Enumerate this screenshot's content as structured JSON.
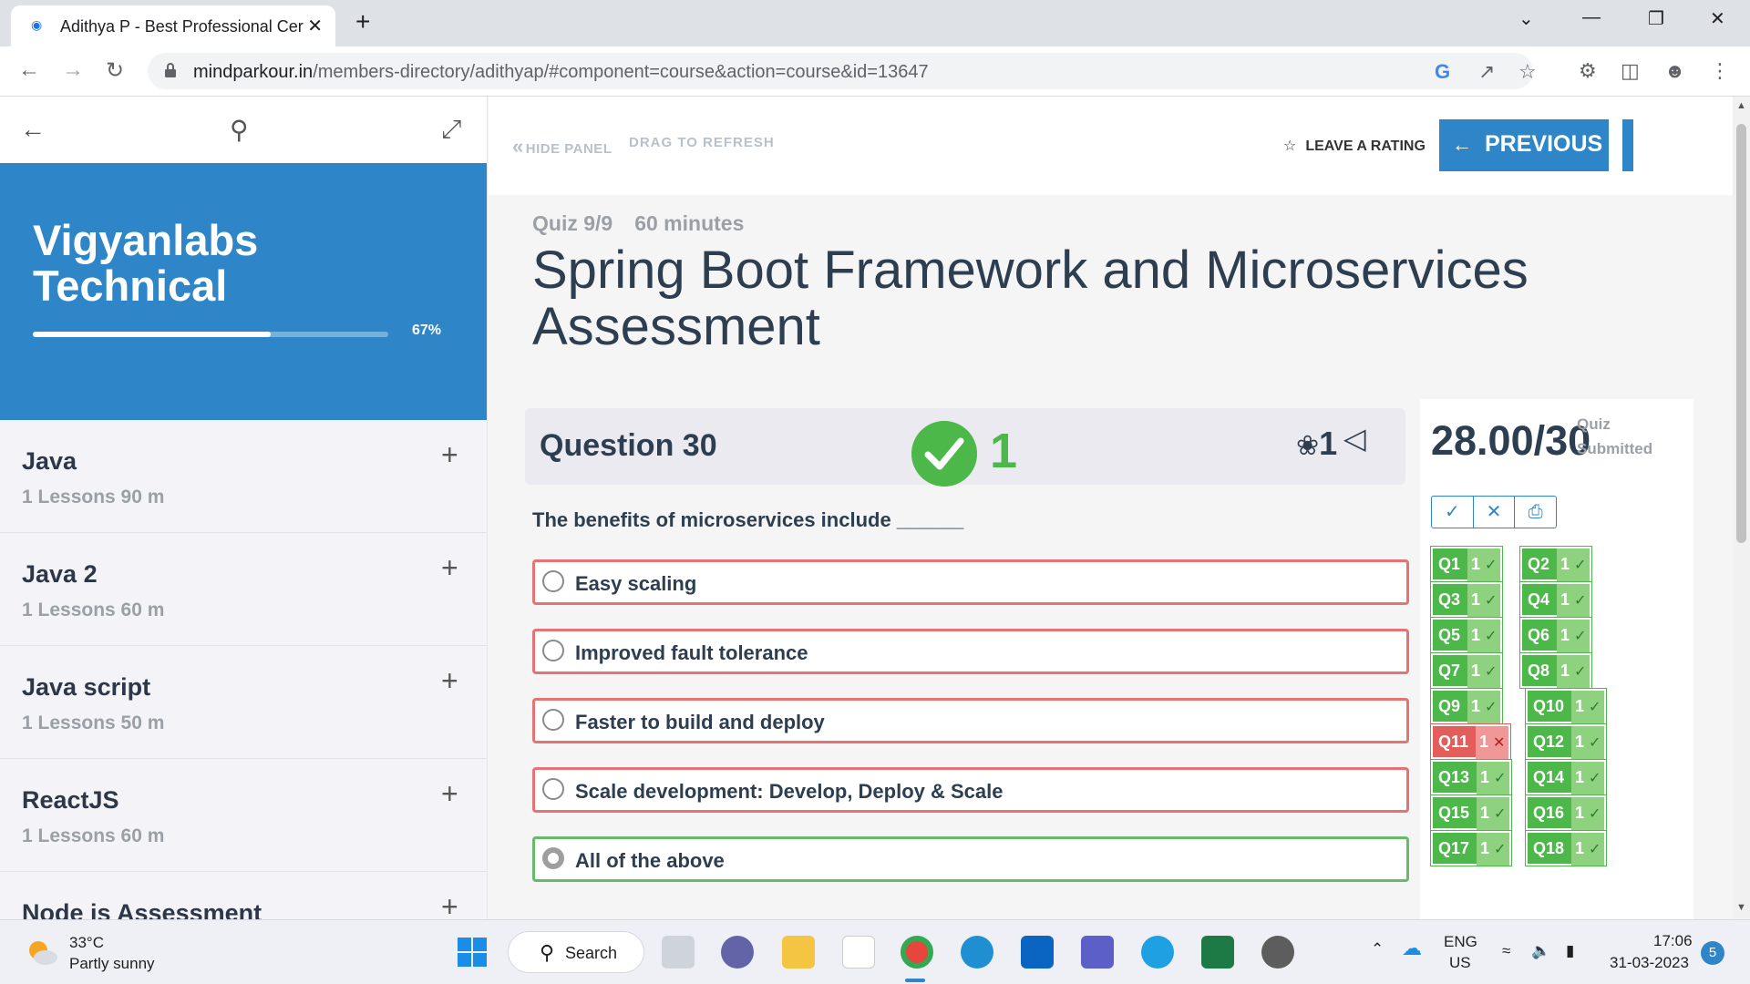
{
  "browser": {
    "tab_title": "Adithya P - Best Professional Cer",
    "url_host": "mindparkour.in",
    "url_path": "/members-directory/adithyap/#component=course&action=course&id=13647"
  },
  "sidebar": {
    "course_title": "Vigyanlabs Technical",
    "progress_pct_label": "67%",
    "progress_value": 0.67,
    "items": [
      {
        "title": "Java",
        "meta": "1 Lessons  90 m"
      },
      {
        "title": "Java 2",
        "meta": "1 Lessons  60 m"
      },
      {
        "title": "Java script",
        "meta": "1 Lessons  50 m"
      },
      {
        "title": "ReactJS",
        "meta": "1 Lessons  60 m"
      },
      {
        "title": "Node js Assessment",
        "meta": ""
      }
    ]
  },
  "header": {
    "hide_panel": "HIDE PANEL",
    "drag_refresh": "DRAG TO REFRESH",
    "leave_rating": "LEAVE A RATING",
    "previous_unit": "PREVIOUS UNIT"
  },
  "quiz": {
    "meta": "Quiz 9/9",
    "duration": "60 minutes",
    "title": "Spring Boot Framework and Microservices Assessment"
  },
  "question": {
    "label": "Question 30",
    "points": "1",
    "award_count": "1",
    "text": "The benefits of microservices include ______",
    "options": [
      {
        "text": "Easy scaling",
        "correct": false
      },
      {
        "text": "Improved fault tolerance",
        "correct": false
      },
      {
        "text": "Faster to build and deploy",
        "correct": false
      },
      {
        "text": "Scale development: Develop, Deploy & Scale",
        "correct": false
      },
      {
        "text": "All of the above",
        "correct": true
      }
    ]
  },
  "score": {
    "value": "28.00/30",
    "status": "Quiz Submitted",
    "chips": [
      {
        "label": "Q1",
        "pts": "1",
        "ok": true
      },
      {
        "label": "Q2",
        "pts": "1",
        "ok": true
      },
      {
        "label": "Q3",
        "pts": "1",
        "ok": true
      },
      {
        "label": "Q4",
        "pts": "1",
        "ok": true
      },
      {
        "label": "Q5",
        "pts": "1",
        "ok": true
      },
      {
        "label": "Q6",
        "pts": "1",
        "ok": true
      },
      {
        "label": "Q7",
        "pts": "1",
        "ok": true
      },
      {
        "label": "Q8",
        "pts": "1",
        "ok": true
      },
      {
        "label": "Q9",
        "pts": "1",
        "ok": true
      },
      {
        "label": "Q10",
        "pts": "1",
        "ok": true
      },
      {
        "label": "Q11",
        "pts": "1",
        "ok": false
      },
      {
        "label": "Q12",
        "pts": "1",
        "ok": true
      },
      {
        "label": "Q13",
        "pts": "1",
        "ok": true
      },
      {
        "label": "Q14",
        "pts": "1",
        "ok": true
      },
      {
        "label": "Q15",
        "pts": "1",
        "ok": true
      },
      {
        "label": "Q16",
        "pts": "1",
        "ok": true
      },
      {
        "label": "Q17",
        "pts": "1",
        "ok": true
      },
      {
        "label": "Q18",
        "pts": "1",
        "ok": true
      }
    ]
  },
  "taskbar": {
    "temp": "33°C",
    "weather": "Partly sunny",
    "search": "Search",
    "lang1": "ENG",
    "lang2": "US",
    "time": "17:06",
    "date": "31-03-2023",
    "notifications": "5"
  },
  "colors": {
    "accent": "#2e86c8",
    "correct": "#4cb849",
    "wrong": "#e35d5b"
  }
}
